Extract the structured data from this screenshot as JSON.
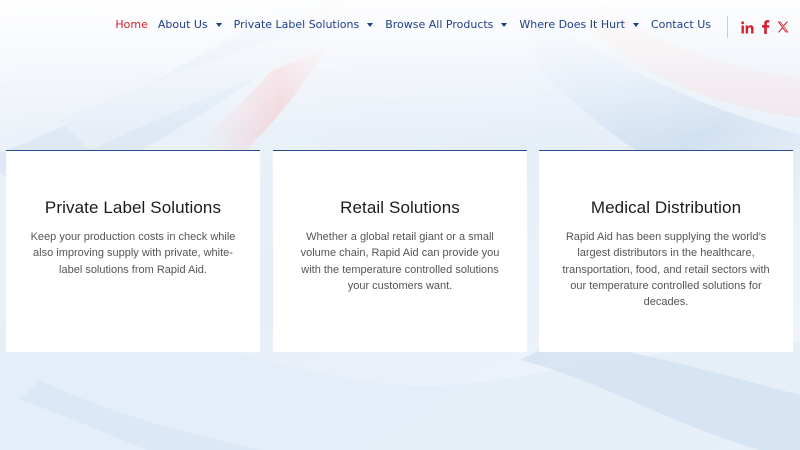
{
  "nav": {
    "items": [
      {
        "label": "Home",
        "active": true,
        "dropdown": false
      },
      {
        "label": "About Us",
        "active": false,
        "dropdown": true
      },
      {
        "label": "Private Label Solutions",
        "active": false,
        "dropdown": true
      },
      {
        "label": "Browse All Products",
        "active": false,
        "dropdown": true
      },
      {
        "label": "Where Does It Hurt",
        "active": false,
        "dropdown": true
      },
      {
        "label": "Contact Us",
        "active": false,
        "dropdown": false
      }
    ]
  },
  "social": {
    "icons": [
      "linkedin-icon",
      "facebook-icon",
      "x-twitter-icon"
    ],
    "color": "#d6202d"
  },
  "colors": {
    "nav_text": "#1f3f8a",
    "nav_active": "#d6202d",
    "card_border": "#284b8c"
  },
  "cards": [
    {
      "title": "Private Label Solutions",
      "text": "Keep your production costs in check while also improving supply with private, white-label solutions from Rapid Aid."
    },
    {
      "title": "Retail Solutions",
      "text": "Whether a global retail giant or a small volume chain, Rapid Aid can provide you with the temperature controlled solutions your customers want."
    },
    {
      "title": "Medical Distribution",
      "text": "Rapid Aid has been supplying the world’s largest distributors in the healthcare, transportation, food, and retail sectors with our temperature controlled solutions for decades."
    }
  ]
}
